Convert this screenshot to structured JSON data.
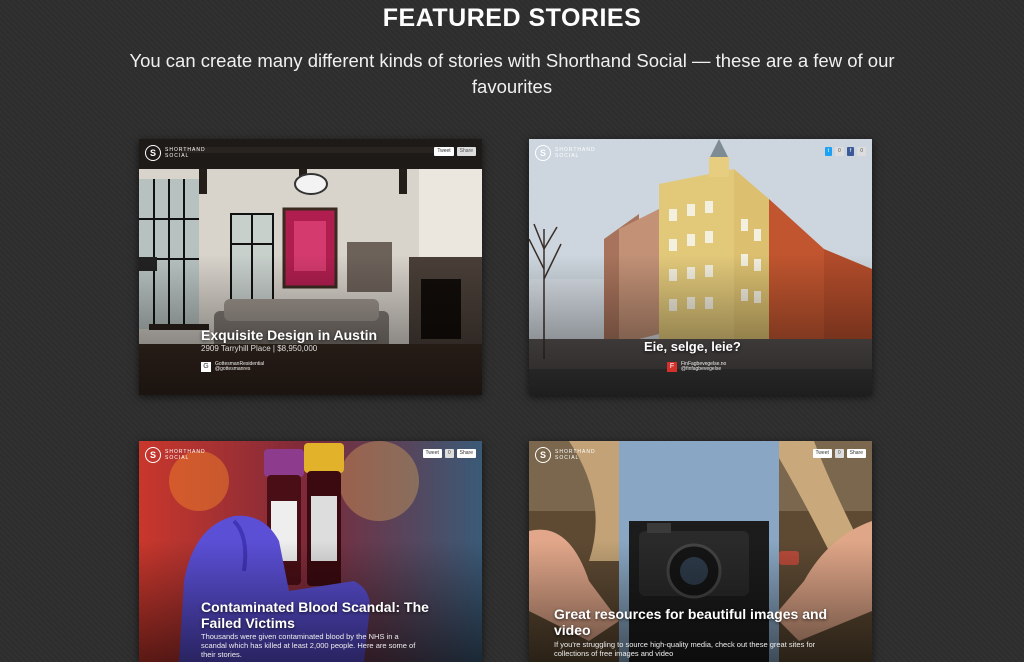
{
  "header": {
    "title": "FEATURED STORIES",
    "intro": "You can create many different kinds of stories with Shorthand Social — these are a few of our favourites"
  },
  "brand": {
    "mark": "S",
    "name": "SHORTHAND SOCIAL"
  },
  "share": {
    "tweet": "Tweet",
    "share": "Share",
    "tweet_icon": "twitter-icon",
    "share_icon": "facebook-icon"
  },
  "cards": [
    {
      "title": "Exquisite Design in Austin",
      "meta": "2909 Tarryhill Place  |  $8,950,000",
      "author": "GottesmanResidential",
      "author_handle": "@gottesmanres"
    },
    {
      "title": "Eie, selge, leie?",
      "author": "FinFagbevegelse.no",
      "author_handle": "@finfagbevegelse"
    },
    {
      "title": "Contaminated Blood Scandal: The Failed Victims",
      "desc": "Thousands were given contaminated blood by the NHS in a scandal which has killed at least 2,000 people. Here are some of their stories."
    },
    {
      "title": "Great resources for beautiful images and video",
      "desc": "If you're struggling to source high-quality media, check out these great sites for collections of free images and video"
    }
  ]
}
